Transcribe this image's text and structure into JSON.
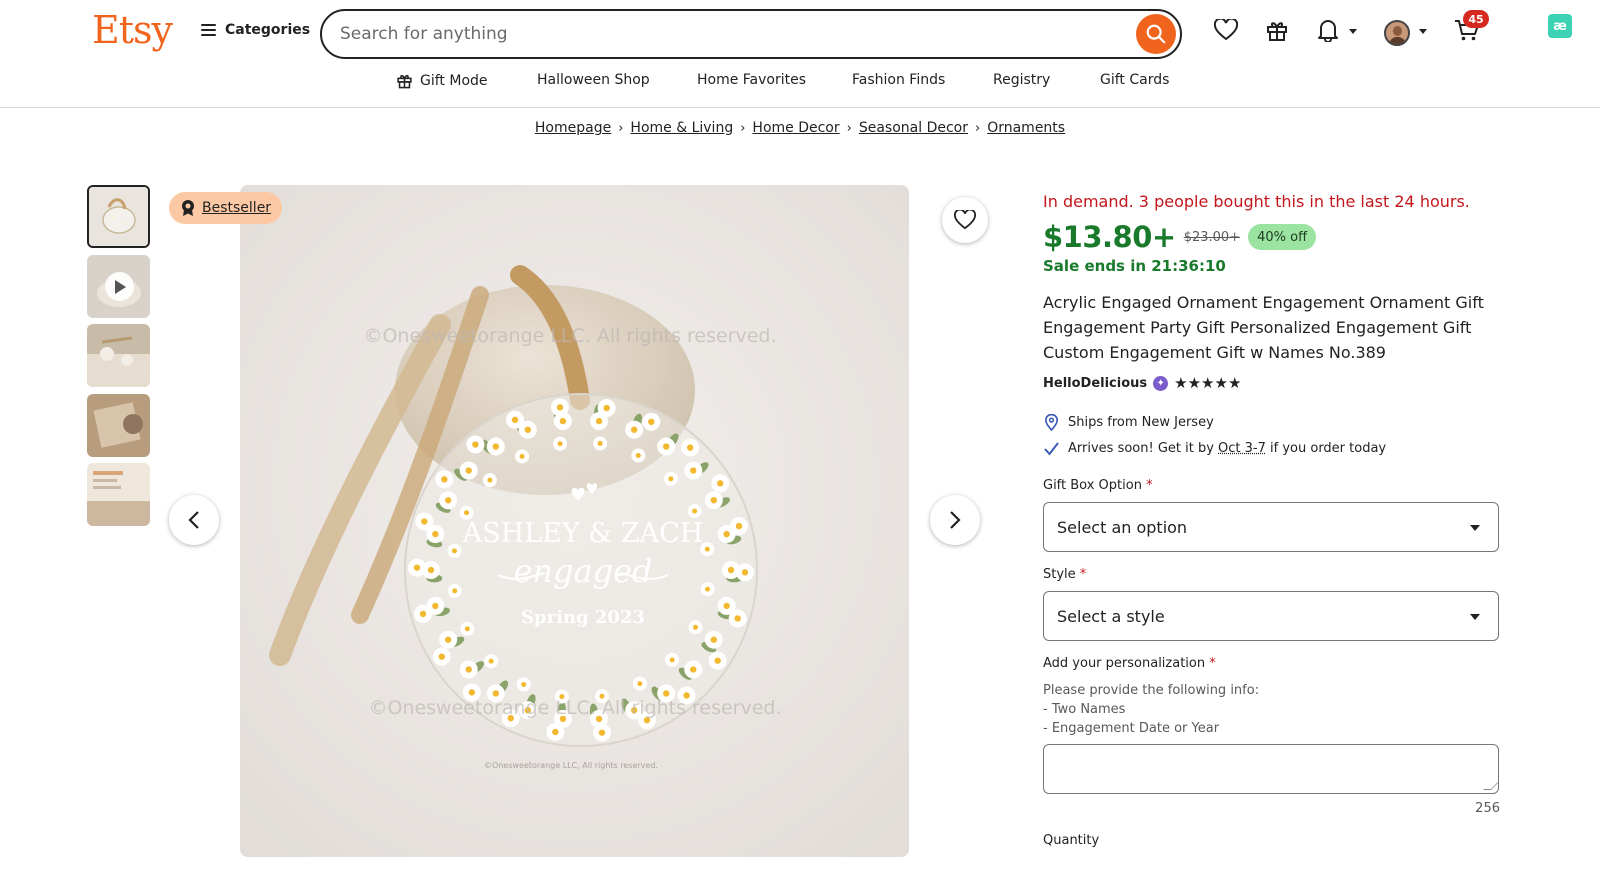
{
  "header": {
    "logo": "Etsy",
    "categories_label": "Categories",
    "search_placeholder": "Search for anything",
    "cart_count": "45"
  },
  "subnav": [
    {
      "label": "Gift Mode",
      "icon": "gift-icon"
    },
    {
      "label": "Halloween Shop"
    },
    {
      "label": "Home Favorites"
    },
    {
      "label": "Fashion Finds"
    },
    {
      "label": "Registry"
    },
    {
      "label": "Gift Cards"
    }
  ],
  "breadcrumb": [
    "Homepage",
    "Home & Living",
    "Home Decor",
    "Seasonal Decor",
    "Ornaments"
  ],
  "gallery": {
    "badge": "Bestseller",
    "image": {
      "watermark": "©Onesweetorange LLC. All rights reserved.",
      "names": "ASHLEY & ZACH",
      "script": "engaged",
      "season": "Spring 2023",
      "footer": "©Onesweetorange LLC, All rights reserved."
    }
  },
  "product": {
    "demand": "In demand. 3 people bought this in the last 24 hours.",
    "price": "$13.80+",
    "old_price": "$23.00+",
    "discount": "40% off",
    "sale_ends": "Sale ends in 21:36:10",
    "title": "Acrylic Engaged Ornament Engagement Ornament Gift Engagement Party Gift Personalized Engagement Gift Custom Engagement Gift w Names No.389",
    "shop_name": "HelloDelicious",
    "rating_stars": "★★★★★",
    "ships_from": "Ships from New Jersey",
    "arrives_prefix": "Arrives soon! Get it by ",
    "arrives_dates": "Oct 3-7",
    "arrives_suffix": " if you order today"
  },
  "options": {
    "gift_box_label": "Gift Box Option",
    "gift_box_value": "Select an option",
    "style_label": "Style",
    "style_value": "Select a style",
    "personalization_label": "Add your personalization",
    "instructions": [
      "Please provide the following info:",
      "- Two Names",
      "- Engagement Date or Year"
    ],
    "char_count": "256",
    "quantity_label": "Quantity",
    "required_mark": "*"
  },
  "colors": {
    "brand": "#f1641e",
    "price_green": "#1a7a2c",
    "demand_red": "#c4161c",
    "badge_peach": "#fdc9a4",
    "discount_green": "#9ae3a0"
  }
}
